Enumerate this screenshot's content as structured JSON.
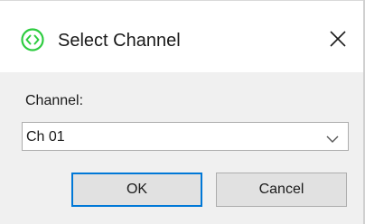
{
  "window": {
    "title": "Select Channel"
  },
  "icons": {
    "app": "channel-app-icon",
    "close": "close-icon",
    "dropdown": "chevron-down-icon"
  },
  "colors": {
    "app_icon": "#2ecc40",
    "focus_border": "#0078d7",
    "client_bg": "#f0f0f0",
    "button_bg": "#e1e1e1"
  },
  "form": {
    "channel_label": "Channel:",
    "channel_value": "Ch 01"
  },
  "buttons": {
    "ok_label": "OK",
    "cancel_label": "Cancel"
  }
}
